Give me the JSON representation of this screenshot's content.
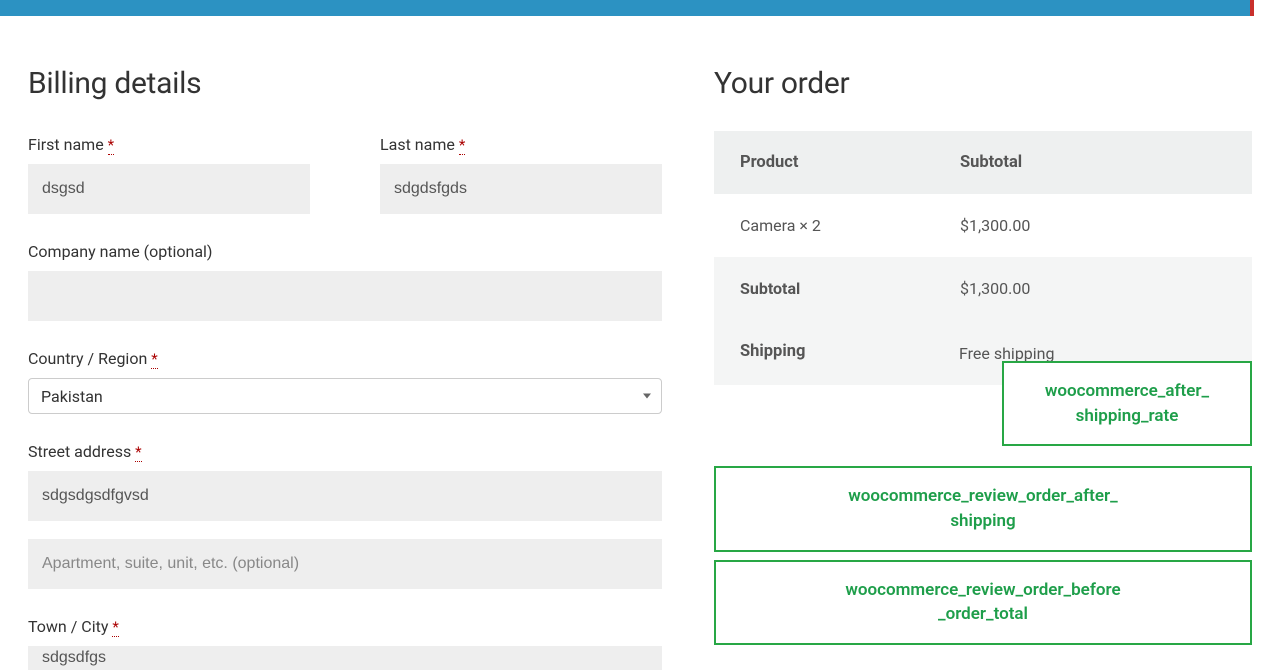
{
  "billing": {
    "title": "Billing details",
    "first_name": {
      "label": "First name",
      "value": "dsgsd"
    },
    "last_name": {
      "label": "Last name",
      "value": "sdgdsfgds"
    },
    "company": {
      "label": "Company name (optional)",
      "value": ""
    },
    "country": {
      "label": "Country / Region",
      "value": "Pakistan"
    },
    "street": {
      "label": "Street address",
      "value": "sdgsdgsdfgvsd",
      "placeholder2": "Apartment, suite, unit, etc. (optional)"
    },
    "town": {
      "label": "Town / City",
      "value": "sdgsdfgs"
    }
  },
  "order": {
    "title": "Your order",
    "head_product": "Product",
    "head_subtotal": "Subtotal",
    "items": [
      {
        "name": "Camera  × 2",
        "subtotal": "$1,300.00"
      }
    ],
    "subtotal_label": "Subtotal",
    "subtotal_value": "$1,300.00",
    "shipping_label": "Shipping",
    "shipping_value": "Free shipping"
  },
  "hooks": {
    "after_shipping_rate": "woocommerce_after_shipping_rate",
    "review_after_shipping": "woocommerce_review_order_after_shipping",
    "review_before_total": "woocommerce_review_order_before_order_total"
  },
  "required_mark": "*"
}
